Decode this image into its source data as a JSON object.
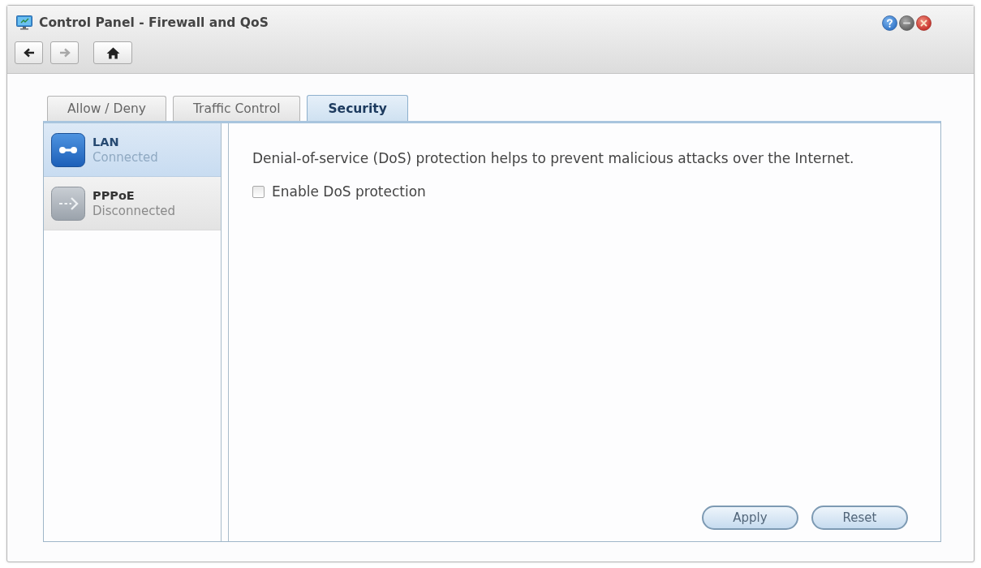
{
  "window": {
    "title": "Control Panel - Firewall and QoS"
  },
  "window_controls": [
    {
      "kind": "help"
    },
    {
      "kind": "minimize"
    },
    {
      "kind": "close"
    }
  ],
  "toolbar": {
    "buttons": [
      {
        "kind": "back",
        "disabled": false
      },
      {
        "kind": "forward",
        "disabled": true
      },
      {
        "kind": "home",
        "disabled": false
      }
    ]
  },
  "tabs": [
    {
      "label": "Allow / Deny",
      "selected": false
    },
    {
      "label": "Traffic Control",
      "selected": false
    },
    {
      "label": "Security",
      "selected": true
    }
  ],
  "sidebar": {
    "items": [
      {
        "title": "LAN",
        "status": "Connected",
        "connected": true,
        "selected": true
      },
      {
        "title": "PPPoE",
        "status": "Disconnected",
        "connected": false,
        "selected": false
      }
    ]
  },
  "content": {
    "description": "Denial-of-service (DoS) protection helps to prevent malicious attacks over the Internet.",
    "checkbox": {
      "label": "Enable DoS protection",
      "checked": false
    },
    "buttons": [
      "Apply",
      "Reset"
    ]
  }
}
